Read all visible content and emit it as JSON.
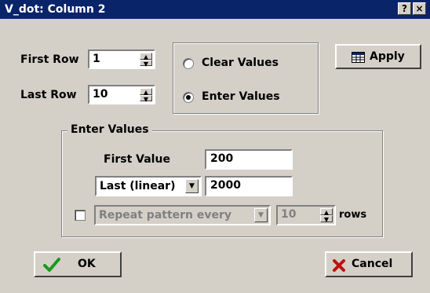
{
  "window": {
    "title": "V_dot: Column 2",
    "help_label": "?",
    "close_label": "×"
  },
  "rows": {
    "first_label": "First Row",
    "first_value": "1",
    "last_label": "Last Row",
    "last_value": "10"
  },
  "mode": {
    "clear_label": "Clear Values",
    "enter_label": "Enter Values",
    "selected": "Enter Values"
  },
  "apply": {
    "label": "Apply",
    "icon": "table-icon"
  },
  "enter_values": {
    "group_label": "Enter Values",
    "first_value_label": "First Value",
    "first_value": "200",
    "last_mode": "Last (linear)",
    "last_value": "2000"
  },
  "repeat": {
    "checked": false,
    "label": "Repeat pattern every",
    "count": "10",
    "unit_label": "rows"
  },
  "footer": {
    "ok_label": "OK",
    "ok_icon": "checkmark-icon",
    "cancel_label": "Cancel",
    "cancel_icon": "x-icon"
  },
  "colors": {
    "titlebar": "#0a246a",
    "dialog": "#d4d0c8",
    "ok_check": "#1a9a1a",
    "cancel_x": "#c01010"
  }
}
